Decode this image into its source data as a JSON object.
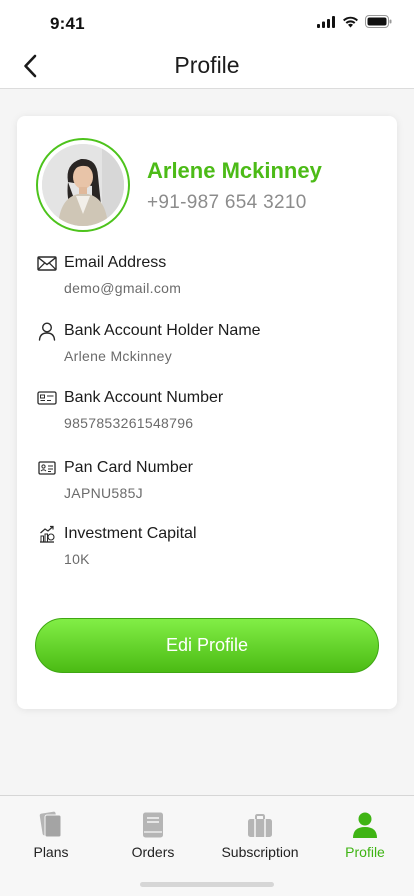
{
  "status_bar": {
    "time": "9:41"
  },
  "header": {
    "title": "Profile"
  },
  "profile": {
    "name": "Arlene Mckinney",
    "phone": "+91-987 654 3210"
  },
  "details": [
    {
      "label": "Email Address",
      "value": "demo@gmail.com",
      "icon": "mail-icon"
    },
    {
      "label": "Bank Account Holder Name",
      "value": "Arlene Mckinney",
      "icon": "user-icon"
    },
    {
      "label": "Bank Account Number",
      "value": "9857853261548796",
      "icon": "bank-card-icon"
    },
    {
      "label": "Pan Card Number",
      "value": "JAPNU585J",
      "icon": "id-card-icon"
    },
    {
      "label": "Investment Capital",
      "value": "10K",
      "icon": "investment-icon"
    }
  ],
  "edit_button": {
    "label": "Edi Profile"
  },
  "tab_bar": {
    "tabs": [
      {
        "label": "Plans",
        "icon": "plans-icon",
        "active": false
      },
      {
        "label": "Orders",
        "icon": "orders-icon",
        "active": false
      },
      {
        "label": "Subscription",
        "icon": "briefcase-icon",
        "active": false
      },
      {
        "label": "Profile",
        "icon": "person-icon",
        "active": true
      }
    ]
  },
  "colors": {
    "accent": "#4cbb17",
    "button_gradient_top": "#82ee46",
    "button_gradient_bottom": "#4bbb14",
    "inactive_icon": "#b5b5b5",
    "background": "#f5f5f5"
  }
}
